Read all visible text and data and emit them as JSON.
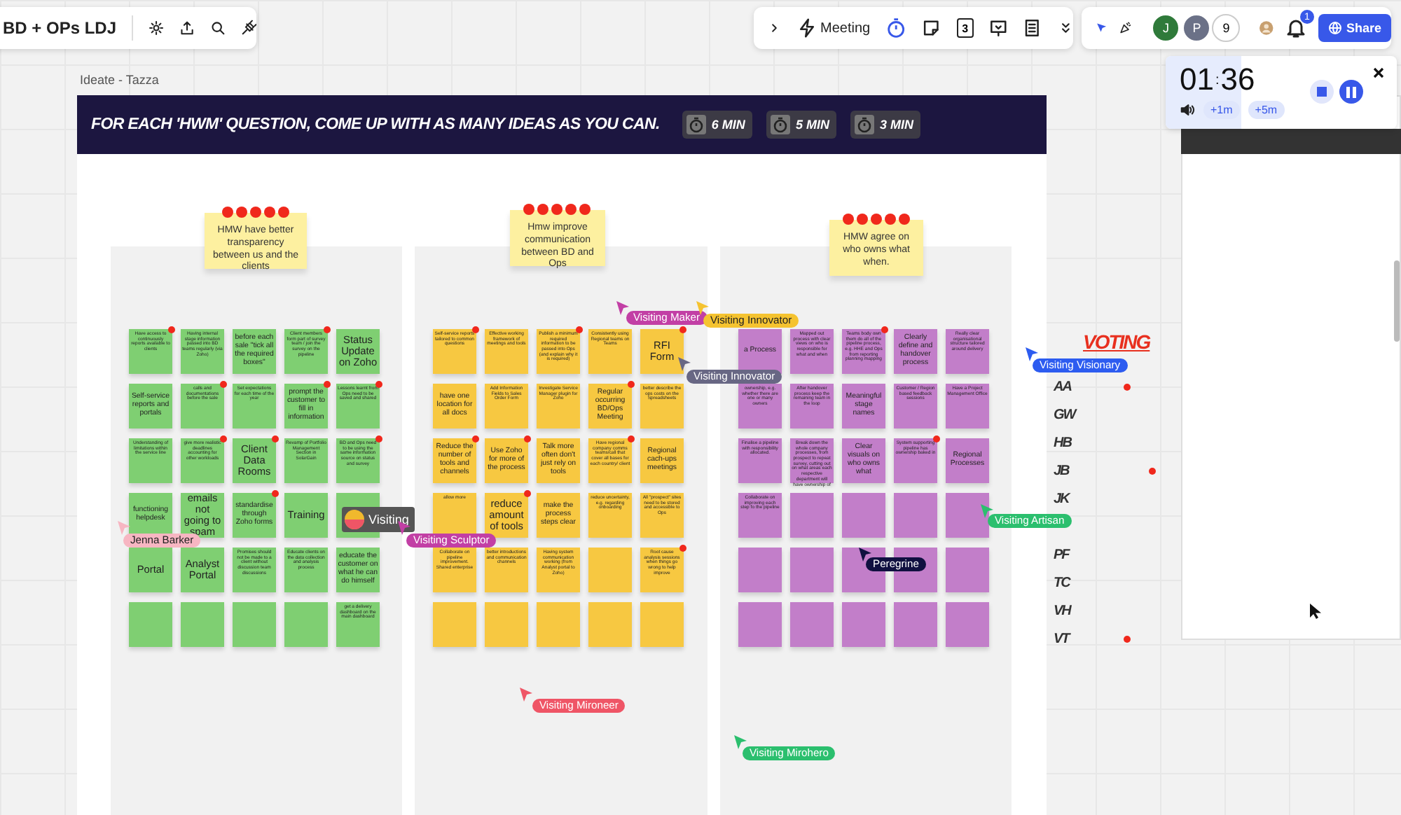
{
  "board": {
    "title": "BD + OPs LDJ"
  },
  "meeting_toolbar": {
    "label": "Meeting",
    "counter": "3"
  },
  "collaborators": {
    "avatars": [
      "J",
      "P"
    ],
    "count": "9",
    "notifications": "1",
    "share": "Share"
  },
  "timer": {
    "minutes": "01",
    "separator": ":",
    "seconds": "36",
    "level": 0.33,
    "add": [
      "+1m",
      "+5m"
    ]
  },
  "frame": {
    "title": "Ideate - Tazza",
    "banner": "FOR EACH 'HWM' QUESTION, COME UP WITH AS MANY IDEAS AS YOU CAN.",
    "timers": [
      "6 MIN",
      "5 MIN",
      "3 MIN"
    ]
  },
  "columns": [
    {
      "color": "#7fcf72",
      "header": {
        "text": "HMW have better transparency between us and the clients",
        "voted": true
      },
      "notes": [
        {
          "kind": "small",
          "text": "Have access to continuously reports available to clients",
          "voted": true
        },
        {
          "kind": "small",
          "text": "Having internal stage information passed into BD teams regularly (via Zoho)",
          "voted": false
        },
        {
          "kind": "mid",
          "text": "before each sale \"tick all the required boxes\"",
          "voted": false
        },
        {
          "kind": "small",
          "text": "Client members form part of survey team / join the survey on the pipeline",
          "voted": true
        },
        {
          "kind": "big",
          "text": "Status Update on Zoho",
          "voted": false
        },
        {
          "kind": "mid",
          "text": "Self-service reports and portals",
          "voted": false
        },
        {
          "kind": "small",
          "text": "calls and documentations before the sale",
          "voted": true
        },
        {
          "kind": "small",
          "text": "Set expectations for each time of the year",
          "voted": false
        },
        {
          "kind": "mid",
          "text": "prompt the customer to fill in information",
          "voted": true
        },
        {
          "kind": "small",
          "text": "Lessons learnt from Ops need to be saved and shared",
          "voted": true
        },
        {
          "kind": "small",
          "text": "Understanding of limitations within the service line",
          "voted": false
        },
        {
          "kind": "small",
          "text": "give more realistic deadlines accounting for other workloads",
          "voted": true
        },
        {
          "kind": "big",
          "text": "Client Data Rooms",
          "voted": true
        },
        {
          "kind": "small",
          "text": "Revamp of Portfolio Management Section in SolarGain",
          "voted": false
        },
        {
          "kind": "small",
          "text": "BD and Ops need to be using the same information source on status and survey",
          "voted": true
        },
        {
          "kind": "mid",
          "text": "functioning helpdesk",
          "voted": false
        },
        {
          "kind": "big",
          "text": "emails not going to spam",
          "voted": false
        },
        {
          "kind": "mid",
          "text": "standardise through Zoho forms",
          "voted": true
        },
        {
          "kind": "big",
          "text": "Training",
          "voted": false
        },
        {
          "kind": "blank"
        },
        {
          "kind": "big",
          "text": "Portal",
          "voted": false
        },
        {
          "kind": "big",
          "text": "Analyst Portal",
          "voted": false
        },
        {
          "kind": "small",
          "text": "Promises should not be made to a client without discussion team discussions",
          "voted": false
        },
        {
          "kind": "small",
          "text": "Educate clients on the data collection and analysis process",
          "voted": false
        },
        {
          "kind": "mid",
          "text": "educate the customer on what he can do himself",
          "voted": false
        },
        {
          "kind": "blank"
        },
        {
          "kind": "blank"
        },
        {
          "kind": "blank"
        },
        {
          "kind": "blank"
        },
        {
          "kind": "small",
          "text": "get a delivery dashboard on the main dashboard",
          "voted": false
        }
      ]
    },
    {
      "color": "#f7c841",
      "header": {
        "text": "Hmw improve communication between BD and Ops",
        "voted": true
      },
      "notes": [
        {
          "kind": "small",
          "text": "Self-service reports tailored to common questions",
          "voted": true
        },
        {
          "kind": "small",
          "text": "Effective working framework of meetings and tools",
          "voted": false
        },
        {
          "kind": "small",
          "text": "Publish a minimum required information to be passed into Ops (and explain why it is required)",
          "voted": true
        },
        {
          "kind": "small",
          "text": "Consistently using Regional teams on Teams",
          "voted": false
        },
        {
          "kind": "big",
          "text": "RFI Form",
          "voted": true
        },
        {
          "kind": "mid",
          "text": "have one location for all docs",
          "voted": false
        },
        {
          "kind": "small",
          "text": "Add Information Fields to Sales Order Form",
          "voted": false
        },
        {
          "kind": "small",
          "text": "Investigate Service Manager plugin for Zoho",
          "voted": false
        },
        {
          "kind": "mid",
          "text": "Regular occurring BD/Ops Meeting",
          "voted": true
        },
        {
          "kind": "small",
          "text": "better describe the ops costs on the Spreadsheets",
          "voted": false
        },
        {
          "kind": "mid",
          "text": "Reduce the number of tools and channels",
          "voted": true
        },
        {
          "kind": "mid",
          "text": "Use Zoho for more of the process",
          "voted": true
        },
        {
          "kind": "mid",
          "text": "Talk more often don't just rely on tools",
          "voted": false
        },
        {
          "kind": "small",
          "text": "Have regional company comms teams/call that cover all bases for each country/ client",
          "voted": true
        },
        {
          "kind": "mid",
          "text": "Regional cach-ups meetings",
          "voted": false
        },
        {
          "kind": "small",
          "text": "allow more",
          "voted": false
        },
        {
          "kind": "big",
          "text": "reduce amount of tools",
          "voted": true
        },
        {
          "kind": "mid",
          "text": "make the process steps clear",
          "voted": false
        },
        {
          "kind": "small",
          "text": "reduce uncertainty, e.g. regarding onboarding",
          "voted": false
        },
        {
          "kind": "small",
          "text": "All \"prospect\" sites need to be stored and accessible to Ops",
          "voted": false
        },
        {
          "kind": "small",
          "text": "Collaborate on pipeline improvement. Shared enterprise",
          "voted": false
        },
        {
          "kind": "small",
          "text": "better introductions and communication channels",
          "voted": false
        },
        {
          "kind": "small",
          "text": "Having system communication working (from Analyst portal to Zoho)",
          "voted": false
        },
        {
          "kind": "blank"
        },
        {
          "kind": "small",
          "text": "Root cause analysis sessions when things go wrong to help improve",
          "voted": true
        },
        {
          "kind": "blank"
        },
        {
          "kind": "blank"
        },
        {
          "kind": "blank"
        },
        {
          "kind": "blank"
        },
        {
          "kind": "blank"
        }
      ]
    },
    {
      "color": "#c27ec9",
      "header": {
        "text": "HMW agree on who owns what when.",
        "voted": true
      },
      "notes": [
        {
          "kind": "mid",
          "text": "a Process",
          "voted": false
        },
        {
          "kind": "small",
          "text": "Mapped out process with clear views on who is responsible for what and when",
          "voted": false
        },
        {
          "kind": "small",
          "text": "Teams body own them do all of the pipeline process, e.g. HHE and Ops from reporting planning mapping",
          "voted": true
        },
        {
          "kind": "mid",
          "text": "Clearly define and handover process",
          "voted": false
        },
        {
          "kind": "small",
          "text": "Really clear organisational structure tailored around delivery",
          "voted": false
        },
        {
          "kind": "small",
          "text": "ownership, e.g. whether there are one or many owners",
          "voted": false
        },
        {
          "kind": "small",
          "text": "After handover process keep the remaining team in the loop",
          "voted": false
        },
        {
          "kind": "mid",
          "text": "Meaningful stage names",
          "voted": false
        },
        {
          "kind": "small",
          "text": "Customer / Region based feedback sessions",
          "voted": false
        },
        {
          "kind": "small",
          "text": "Have a Project Management Office",
          "voted": false
        },
        {
          "kind": "small",
          "text": "Finalise a pipeline with responsibility allocated.",
          "voted": false
        },
        {
          "kind": "small",
          "text": "Break down the whole company processes, from prospect to repeat survey, cutting out on what areas each respective department will have ownership of",
          "voted": false
        },
        {
          "kind": "mid",
          "text": "Clear visuals on who owns what",
          "voted": false
        },
        {
          "kind": "small",
          "text": "System supporting pipeline has ownership baked in",
          "voted": true
        },
        {
          "kind": "mid",
          "text": "Regional Processes",
          "voted": false
        },
        {
          "kind": "small",
          "text": "Collaborate on improving each step fo the pipeline",
          "voted": false
        },
        {
          "kind": "blank"
        },
        {
          "kind": "blank"
        },
        {
          "kind": "blank"
        },
        {
          "kind": "blank"
        },
        {
          "kind": "blank"
        },
        {
          "kind": "blank"
        },
        {
          "kind": "blank"
        },
        {
          "kind": "blank"
        },
        {
          "kind": "blank"
        },
        {
          "kind": "blank"
        },
        {
          "kind": "blank"
        },
        {
          "kind": "blank"
        },
        {
          "kind": "blank"
        },
        {
          "kind": "blank"
        }
      ]
    }
  ],
  "voting": {
    "title": "VOTING",
    "people": [
      {
        "initials": "AA",
        "voted": true
      },
      {
        "initials": "GW",
        "voted": false
      },
      {
        "initials": "HB",
        "voted": false
      },
      {
        "initials": "JB",
        "voted": true
      },
      {
        "initials": "JK",
        "voted": false
      },
      {
        "initials": "PF",
        "voted": false
      },
      {
        "initials": "TC",
        "voted": false
      },
      {
        "initials": "VH",
        "voted": false
      },
      {
        "initials": "VT",
        "voted": true
      }
    ]
  },
  "cursors": [
    {
      "kind": "arrow",
      "name": "Visiting Maker",
      "color": "#c23fa5"
    },
    {
      "kind": "arrow",
      "name": "Visiting Innovator",
      "color": "#f5c330"
    },
    {
      "kind": "arrow",
      "name": "Visiting Innovator",
      "color": "#686784"
    },
    {
      "kind": "arrow",
      "name": "Visiting Visionary",
      "color": "#2d5cf0"
    },
    {
      "kind": "arrow",
      "name": "Visiting Artisan",
      "color": "#2bbf6e"
    },
    {
      "kind": "arrow",
      "name": "Peregrine",
      "color": "#101040"
    },
    {
      "kind": "avatar",
      "name": "Visiting",
      "color": "#555555"
    },
    {
      "kind": "arrow",
      "name": "Jenna Barker",
      "color": "#f7b6c2"
    },
    {
      "kind": "arrow",
      "name": "Visiting Sculptor",
      "color": "#c23fa5"
    },
    {
      "kind": "arrow",
      "name": "Visiting Mironeer",
      "color": "#ef5566"
    },
    {
      "kind": "arrow",
      "name": "Visiting Mirohero",
      "color": "#2bbf6e"
    }
  ]
}
